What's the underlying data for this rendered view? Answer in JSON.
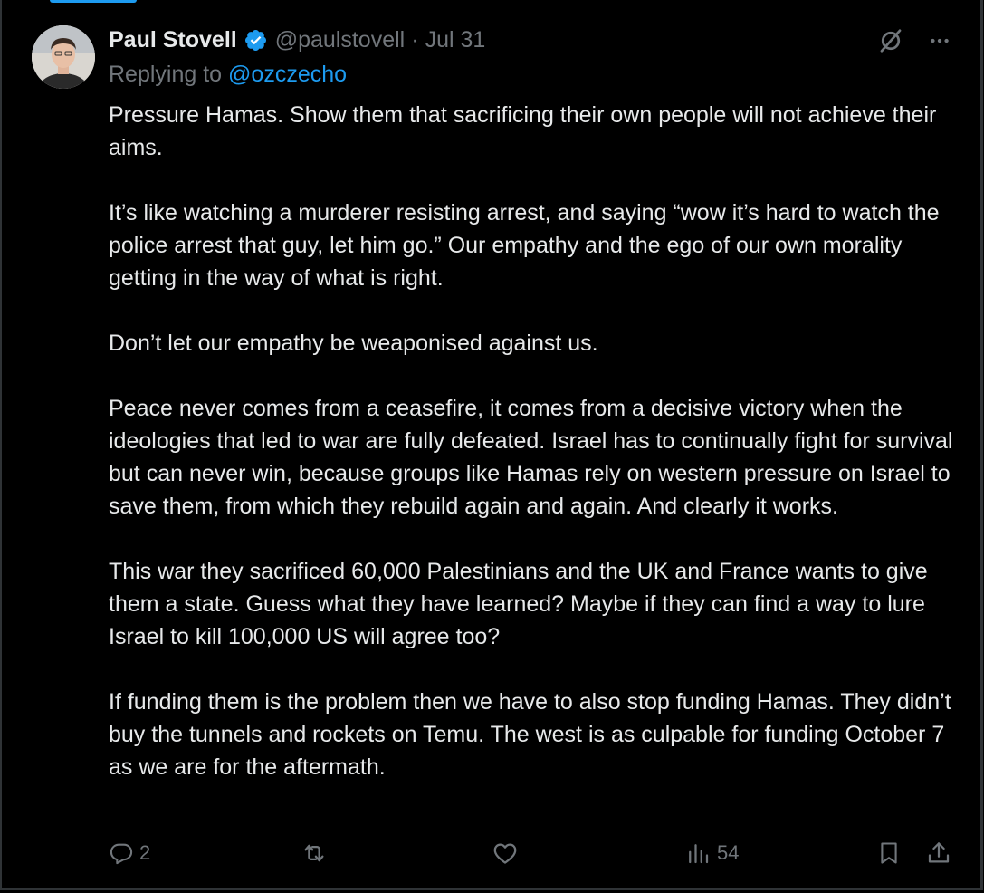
{
  "tweet": {
    "author": {
      "display_name": "Paul Stovell",
      "handle": "@paulstovell",
      "verified": true
    },
    "separator": "·",
    "date": "Jul 31",
    "replying_to_prefix": "Replying to",
    "replying_to_handle": "@ozczecho",
    "paragraphs": [
      "Pressure Hamas. Show them that sacrificing their own people will not achieve their aims.",
      "It’s like watching a murderer resisting arrest, and saying “wow it’s hard to watch the police arrest that guy, let him go.” Our empathy and the ego of our own morality getting in the way of what is right.",
      "Don’t let our empathy be weaponised against us.",
      "Peace never comes from a ceasefire, it comes from a decisive victory when the ideologies that led to war are fully defeated. Israel has to continually fight for survival but can never win, because groups like Hamas rely on western pressure on Israel to save them, from which they rebuild again and again. And clearly it works.",
      "This war they sacrificed 60,000 Palestinians and the UK and France wants to give them a state. Guess what they have learned? Maybe if they can find a way to lure Israel to kill 100,000 US will agree too?",
      "If funding them is the problem then we have to also stop funding Hamas. They didn’t buy the tunnels and rockets on Temu. The west is as culpable for funding October 7 as we are for the aftermath."
    ],
    "stats": {
      "replies": "2",
      "views": "54"
    },
    "icons": {
      "verified": "verified-badge-icon",
      "grok": "grok-icon",
      "more": "more-icon",
      "reply": "reply-icon",
      "retweet": "retweet-icon",
      "like": "like-icon",
      "views": "views-icon",
      "bookmark": "bookmark-icon",
      "share": "share-icon"
    }
  },
  "colors": {
    "background": "#000000",
    "text": "#e7e9ea",
    "secondary": "#71767b",
    "accent": "#1d9bf0",
    "border": "#2f3336"
  }
}
